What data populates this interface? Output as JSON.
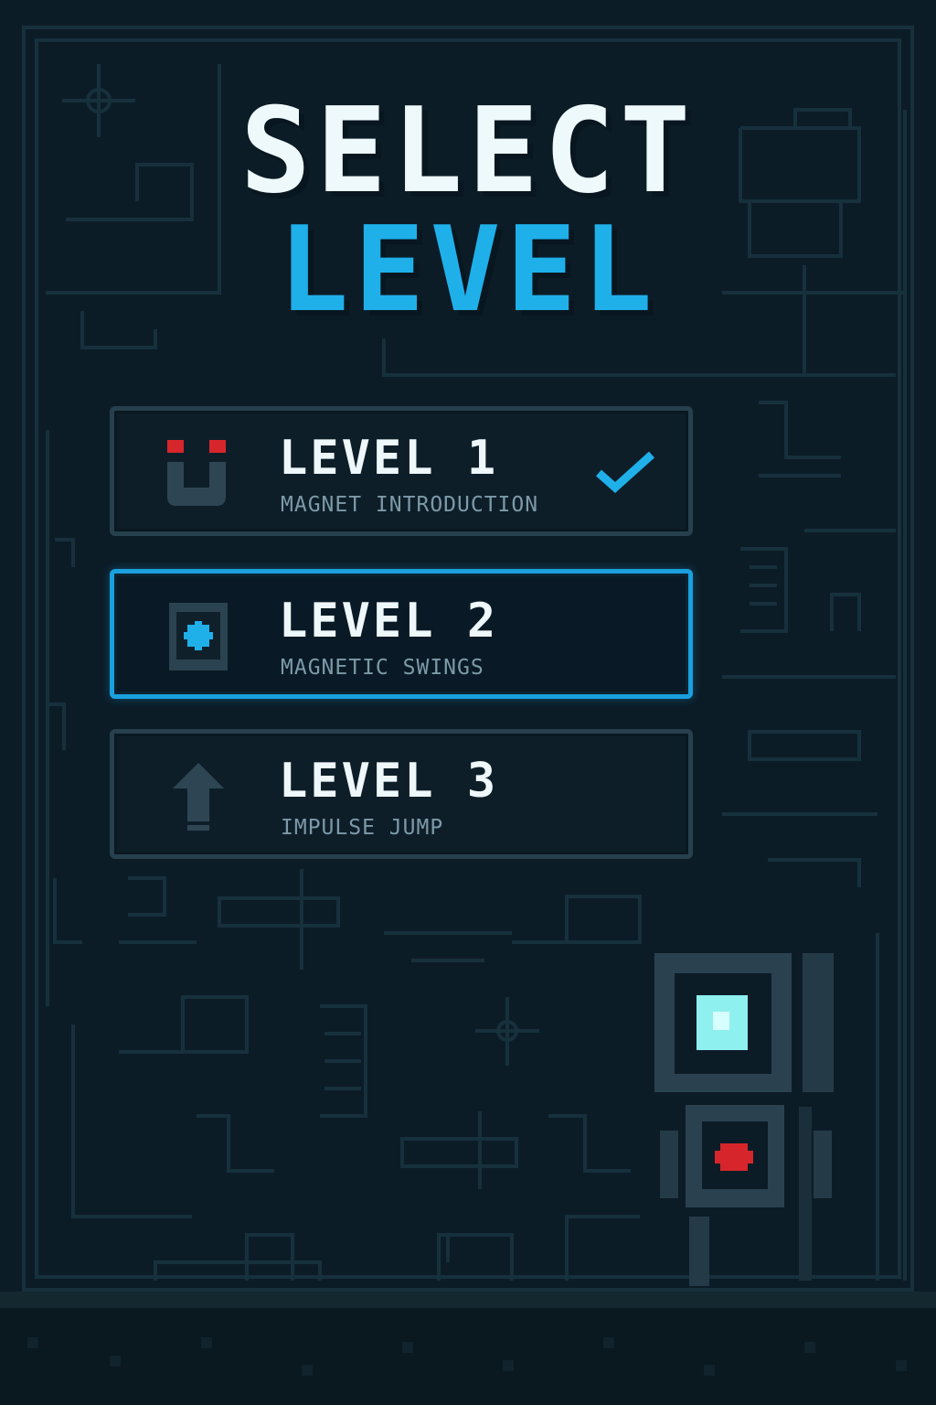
{
  "title": {
    "line1": "SELECT",
    "line2": "LEVEL"
  },
  "levels": [
    {
      "label": "LEVEL 1",
      "subtitle": "MAGNET INTRODUCTION",
      "icon": "magnet-icon",
      "completed": true,
      "selected": false
    },
    {
      "label": "LEVEL 2",
      "subtitle": "MAGNETIC SWINGS",
      "icon": "node-icon",
      "completed": false,
      "selected": true
    },
    {
      "label": "LEVEL 3",
      "subtitle": "IMPULSE JUMP",
      "icon": "arrow-up-icon",
      "completed": false,
      "selected": false
    }
  ],
  "colors": {
    "background": "#0c1c27",
    "accent": "#1fb0ea",
    "title": "#eef9fb",
    "magnet_red": "#d6262c",
    "check": "#1fb0ea",
    "device_light": "#8ff0f0",
    "device_button": "#d6262c"
  }
}
